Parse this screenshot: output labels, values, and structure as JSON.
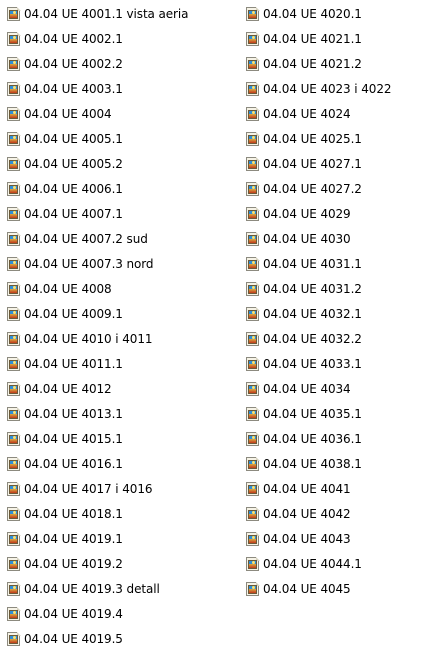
{
  "icons": {
    "file_icon": "image-file-icon"
  },
  "columns": [
    {
      "items": [
        "04.04 UE 4001.1 vista aeria",
        "04.04 UE 4002.1",
        "04.04 UE 4002.2",
        "04.04 UE 4003.1",
        "04.04 UE 4004",
        "04.04 UE 4005.1",
        "04.04 UE 4005.2",
        "04.04 UE 4006.1",
        "04.04 UE 4007.1",
        "04.04 UE 4007.2 sud",
        "04.04 UE 4007.3 nord",
        "04.04 UE 4008",
        "04.04 UE 4009.1",
        "04.04 UE 4010 i 4011",
        "04.04 UE 4011.1",
        "04.04 UE 4012",
        "04.04 UE 4013.1",
        "04.04 UE 4015.1",
        "04.04 UE 4016.1",
        "04.04 UE 4017 i 4016",
        "04.04 UE 4018.1",
        "04.04 UE 4019.1",
        "04.04 UE 4019.2",
        "04.04 UE 4019.3 detall",
        "04.04 UE 4019.4",
        "04.04 UE 4019.5"
      ]
    },
    {
      "items": [
        "04.04 UE 4020.1",
        "04.04 UE 4021.1",
        "04.04 UE 4021.2",
        "04.04 UE 4023 i 4022",
        "04.04 UE 4024",
        "04.04 UE 4025.1",
        "04.04 UE 4027.1",
        "04.04 UE 4027.2",
        "04.04 UE 4029",
        "04.04 UE 4030",
        "04.04 UE 4031.1",
        "04.04 UE 4031.2",
        "04.04 UE 4032.1",
        "04.04 UE 4032.2",
        "04.04 UE 4033.1",
        "04.04 UE 4034",
        "04.04 UE 4035.1",
        "04.04 UE 4036.1",
        "04.04 UE 4038.1",
        "04.04 UE 4041",
        "04.04 UE 4042",
        "04.04 UE 4043",
        "04.04 UE 4044.1",
        "04.04 UE 4045"
      ]
    }
  ]
}
